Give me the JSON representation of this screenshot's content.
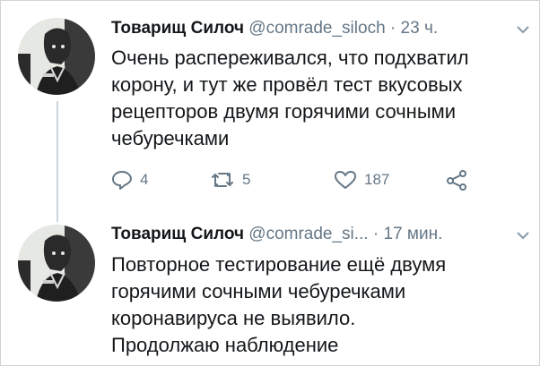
{
  "tweets": [
    {
      "name": "Товарищ Силоч",
      "handle": "@comrade_siloch",
      "separator": "·",
      "time": "23 ч.",
      "lines": [
        "Очень распереживался, что подхватил",
        "корону, и тут же провёл тест вкусовых",
        "рецепторов двумя горячими сочными",
        "чебуречками"
      ],
      "actions": {
        "replies": "4",
        "retweets": "5",
        "likes": "187"
      }
    },
    {
      "name": "Товарищ Силоч",
      "handle": "@comrade_si...",
      "separator": "·",
      "time": "17 мин.",
      "lines": [
        "Повторное тестирование ещё двумя",
        "горячими сочными чебуречками",
        "коронавируса не выявило.",
        "Продолжаю наблюдение"
      ]
    }
  ],
  "icons": {
    "reply": "reply-icon",
    "retweet": "retweet-icon",
    "like": "heart-icon",
    "share": "share-icon",
    "caret": "chevron-down-icon"
  },
  "colors": {
    "text": "#14171a",
    "muted": "#657786",
    "thread": "#cdd6dd"
  }
}
